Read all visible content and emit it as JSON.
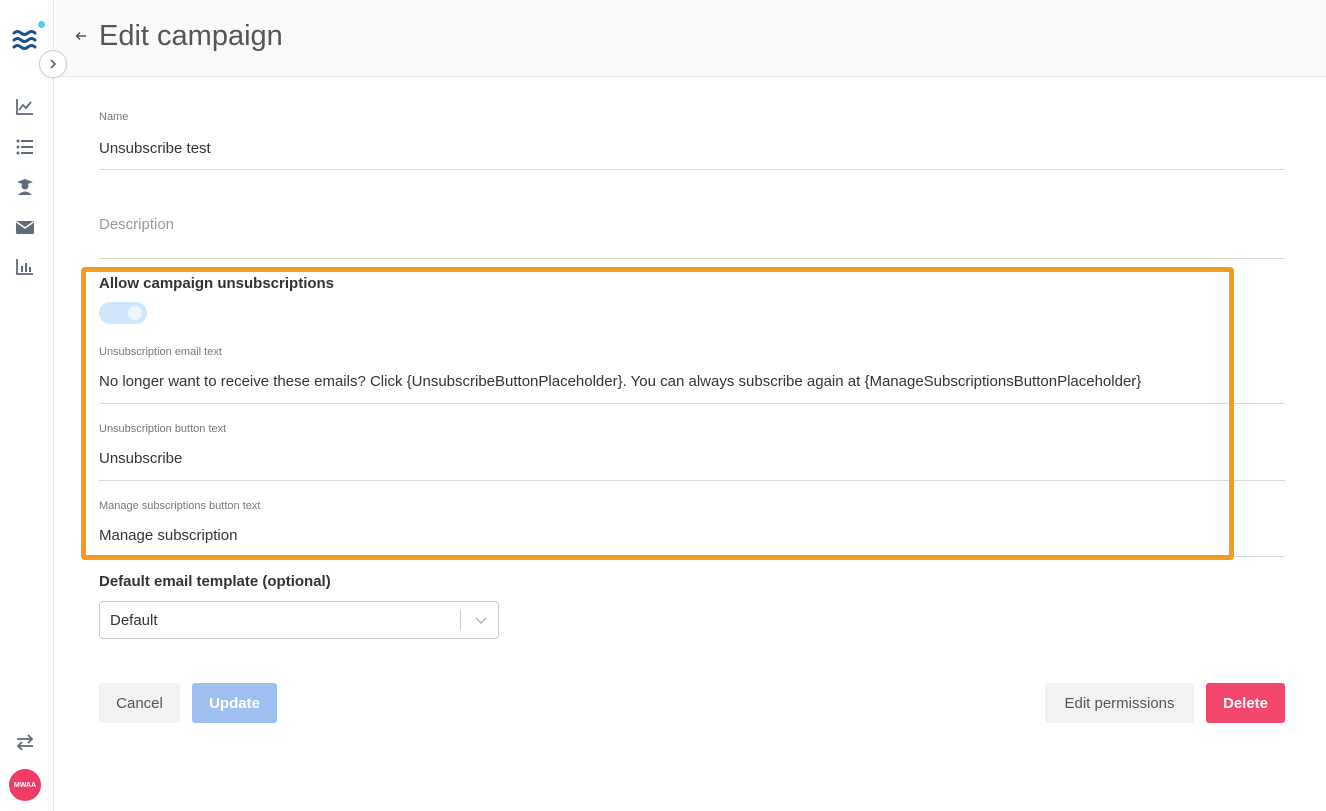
{
  "header": {
    "title": "Edit campaign"
  },
  "sidebar": {
    "avatar_initials": "MWAA",
    "items": [
      {
        "icon": "line-chart-icon"
      },
      {
        "icon": "list-icon"
      },
      {
        "icon": "graduate-icon"
      },
      {
        "icon": "envelope-icon"
      },
      {
        "icon": "bar-chart-icon"
      }
    ],
    "bottom_icon": "swap-icon"
  },
  "form": {
    "name_label": "Name",
    "name_value": "Unsubscribe test",
    "description_placeholder": "Description",
    "unsubscribe_heading": "Allow campaign unsubscriptions",
    "unsubscribe_enabled": true,
    "email_text_label": "Unsubscription email text",
    "email_text_value": "No longer want to receive these emails? Click {UnsubscribeButtonPlaceholder}. You can always subscribe again at {ManageSubscriptionsButtonPlaceholder}",
    "button_text_label": "Unsubscription button text",
    "button_text_value": "Unsubscribe",
    "manage_text_label": "Manage subscriptions button text",
    "manage_text_value": "Manage subscription",
    "template_heading": "Default email template (optional)",
    "template_selected": "Default"
  },
  "actions": {
    "cancel": "Cancel",
    "update": "Update",
    "edit_permissions": "Edit permissions",
    "delete": "Delete"
  },
  "colors": {
    "highlight": "#f39c1f",
    "primary_disabled": "#9dc0f1",
    "danger": "#f2476a",
    "brand": "#1f4e8c"
  }
}
